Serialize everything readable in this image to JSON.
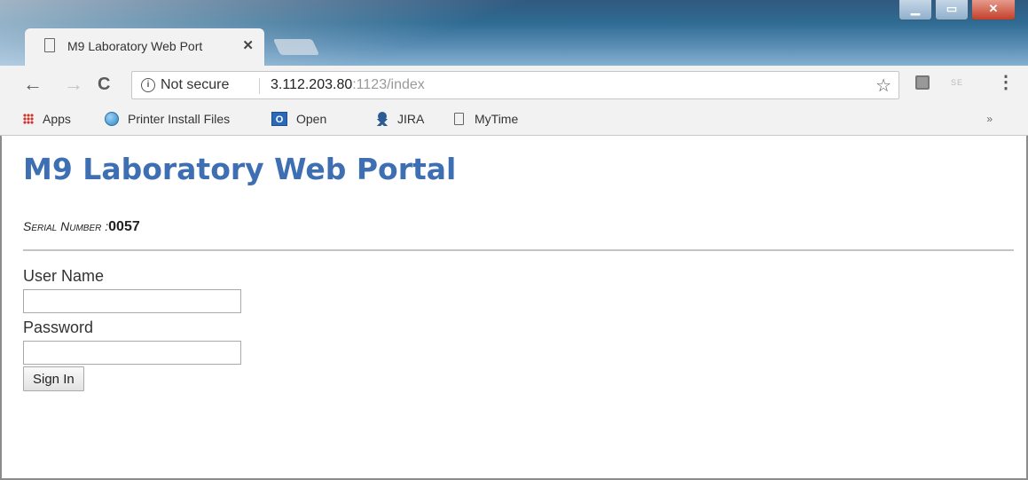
{
  "browser": {
    "tab": {
      "title": "M9 Laboratory Web Port",
      "close": "✕"
    },
    "window_controls": {
      "minimize": "▁",
      "maximize": "▭",
      "close": "✕"
    },
    "toolbar": {
      "back": "←",
      "forward": "→",
      "reload": "C",
      "security_text": "Not secure",
      "url_host": "3.112.203.80",
      "url_rest": ":1123/index",
      "star": "☆",
      "menu": "⋮",
      "extension_label": "SE"
    },
    "bookmarks": [
      {
        "label": "Apps",
        "icon": "apps-grid-icon"
      },
      {
        "label": "Printer Install Files",
        "icon": "globe-icon"
      },
      {
        "label": "Open",
        "icon": "outlook-icon"
      },
      {
        "label": "JIRA",
        "icon": "jira-icon"
      },
      {
        "label": "MyTime",
        "icon": "page-icon"
      }
    ],
    "bookmarks_more": "»"
  },
  "page": {
    "title": "M9 Laboratory Web Portal",
    "serial_label": "Serial Number :",
    "serial_value": "0057",
    "username_label": "User Name",
    "username_value": "",
    "password_label": "Password",
    "password_value": "",
    "signin_label": "Sign In"
  },
  "colors": {
    "title": "#3f6fb3",
    "chrome_bg": "#f2f2f2"
  }
}
